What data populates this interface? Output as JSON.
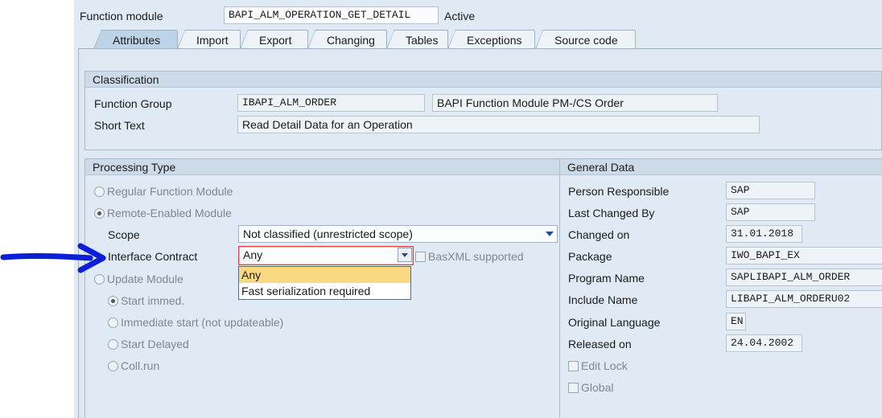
{
  "header": {
    "function_module_label": "Function module",
    "function_module_value": "BAPI_ALM_OPERATION_GET_DETAIL",
    "status": "Active"
  },
  "tabs": [
    {
      "label": "Attributes",
      "active": true
    },
    {
      "label": "Import"
    },
    {
      "label": "Export"
    },
    {
      "label": "Changing"
    },
    {
      "label": "Tables"
    },
    {
      "label": "Exceptions"
    },
    {
      "label": "Source code"
    }
  ],
  "classification": {
    "title": "Classification",
    "function_group_label": "Function Group",
    "function_group_value": "IBAPI_ALM_ORDER",
    "function_group_desc": "BAPI Function Module PM-/CS Order",
    "short_text_label": "Short Text",
    "short_text_value": "Read Detail Data for an Operation"
  },
  "processing_type": {
    "title": "Processing Type",
    "regular": "Regular Function Module",
    "remote": "Remote-Enabled Module",
    "scope_label": "Scope",
    "scope_value": "Not classified (unrestricted scope)",
    "interface_contract_label": "Interface Contract",
    "interface_contract_value": "Any",
    "basxml_label": "BasXML supported",
    "dropdown_options": [
      "Any",
      "Fast serialization required"
    ],
    "update_module": "Update Module",
    "start_immed": "Start immed.",
    "immediate_start": "Immediate start (not updateable)",
    "start_delayed": "Start Delayed",
    "coll_run": "Coll.run"
  },
  "general_data": {
    "title": "General Data",
    "person_responsible_label": "Person Responsible",
    "person_responsible_value": "SAP",
    "last_changed_by_label": "Last Changed By",
    "last_changed_by_value": "SAP",
    "changed_on_label": "Changed on",
    "changed_on_value": "31.01.2018",
    "package_label": "Package",
    "package_value": "IWO_BAPI_EX",
    "program_name_label": "Program Name",
    "program_name_value": "SAPLIBAPI_ALM_ORDER",
    "include_name_label": "Include Name",
    "include_name_value": "LIBAPI_ALM_ORDERU02",
    "original_language_label": "Original Language",
    "original_language_value": "EN",
    "released_on_label": "Released on",
    "released_on_value": "24.04.2002",
    "edit_lock": "Edit Lock",
    "global": "Global"
  },
  "colors": {
    "annotation_arrow": "#0a1fd6",
    "dropdown_highlight": "#fbd882",
    "focus_border": "#d9413a"
  }
}
